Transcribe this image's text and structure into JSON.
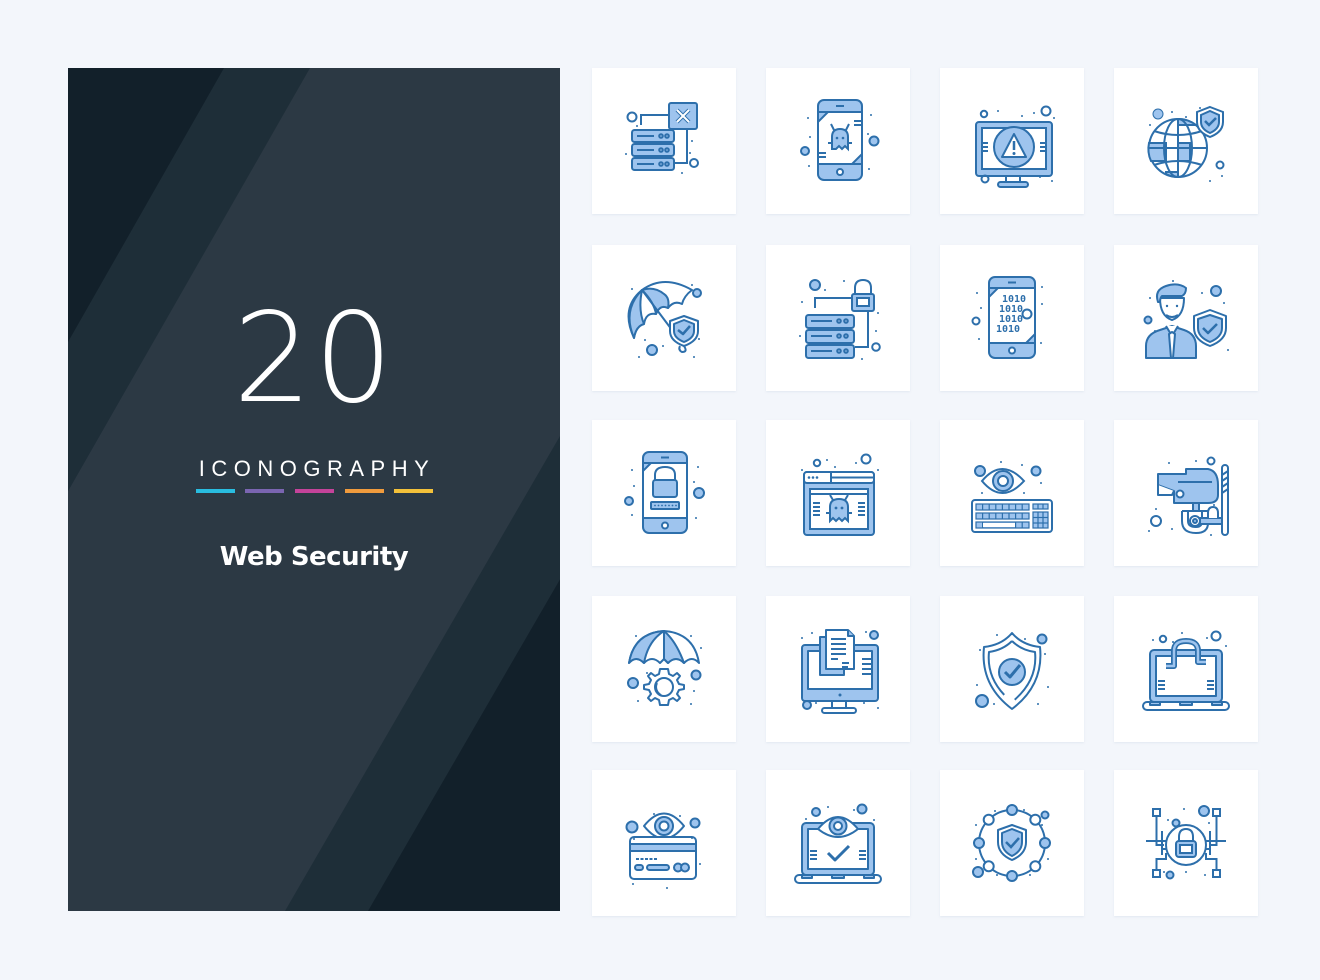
{
  "cover": {
    "count": "20",
    "series_label": "ICONOGRAPHY",
    "title": "Web Security",
    "accent_bars": [
      "#29bde0",
      "#7a65b1",
      "#c4439a",
      "#f09b3d",
      "#f3c13a"
    ],
    "background": "#2c3944"
  },
  "icon_style": {
    "stroke": "#2d6fab",
    "fill": "#9ec4ee",
    "tile_background": "#ffffff",
    "page_background": "#f3f6fb"
  },
  "icons": [
    {
      "name": "server-error-icon",
      "label": "Server error"
    },
    {
      "name": "mobile-bug-icon",
      "label": "Mobile bug"
    },
    {
      "name": "monitor-warning-icon",
      "label": "Monitor warning"
    },
    {
      "name": "global-shield-icon",
      "label": "Global protection"
    },
    {
      "name": "umbrella-shield-icon",
      "label": "Umbrella protection"
    },
    {
      "name": "server-lock-icon",
      "label": "Server lock"
    },
    {
      "name": "mobile-binary-icon",
      "label": "Mobile binary"
    },
    {
      "name": "user-shield-icon",
      "label": "User protection"
    },
    {
      "name": "mobile-lock-icon",
      "label": "Mobile lock"
    },
    {
      "name": "browser-bug-icon",
      "label": "Browser bug"
    },
    {
      "name": "keyboard-eye-icon",
      "label": "Keylogger"
    },
    {
      "name": "cctv-camera-icon",
      "label": "CCTV camera"
    },
    {
      "name": "umbrella-gear-icon",
      "label": "Protected settings"
    },
    {
      "name": "monitor-documents-icon",
      "label": "Monitor documents"
    },
    {
      "name": "shield-check-icon",
      "label": "Shield check"
    },
    {
      "name": "laptop-lock-icon",
      "label": "Laptop lock"
    },
    {
      "name": "card-eye-icon",
      "label": "Card monitoring"
    },
    {
      "name": "laptop-eye-check-icon",
      "label": "Laptop verified"
    },
    {
      "name": "network-shield-icon",
      "label": "Network protection"
    },
    {
      "name": "circuit-lock-icon",
      "label": "Circuit lock"
    }
  ]
}
